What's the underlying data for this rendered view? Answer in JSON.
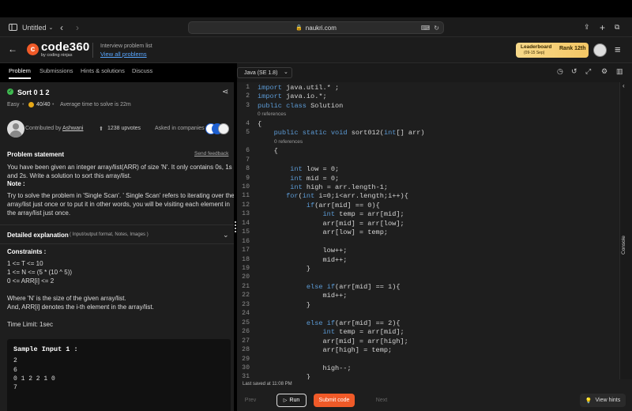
{
  "browser": {
    "tab_title": "Untitled",
    "url": "naukri.com"
  },
  "app": {
    "logo_text": "code360",
    "logo_sub": "by coding ninjas",
    "breadcrumb_label": "Interview problem list",
    "breadcrumb_link": "View all problems",
    "leaderboard_title": "Leaderboard",
    "leaderboard_dates": "(09-15 Sep)",
    "rank_label": "Rank",
    "rank_value": "12th"
  },
  "tabs": [
    "Problem",
    "Submissions",
    "Hints & solutions",
    "Discuss"
  ],
  "problem": {
    "title": "Sort 0 1 2",
    "difficulty": "Easy",
    "score": "40/40",
    "avg_time": "Average time to solve is 22m",
    "contributed_label": "Contributed by",
    "contributor": "Ashwani",
    "upvotes": "1238 upvotes",
    "asked_label": "Asked in companies",
    "statement_heading": "Problem statement",
    "feedback_link": "Send feedback",
    "statement_lines": [
      "You have been given an integer array/list(ARR) of size 'N'. It only contains 0s, 1s",
      "and 2s. Write a solution to sort this array/list."
    ],
    "note_label": "Note :",
    "note_lines": [
      "Try to solve the problem in 'Single Scan'. ' Single Scan' refers to iterating over the",
      "array/list just once or to put it in other words, you will be visiting each element in",
      "the array/list just once."
    ],
    "detailed_label": "Detailed explanation",
    "detailed_sub": "( Input/output format, Notes, Images )",
    "constraints_label": "Constraints :",
    "constraints": [
      "1 <= T <= 10",
      "1 <= N <= (5 * (10 ^ 5))",
      "0 <= ARR[i] <= 2"
    ],
    "where_lines": [
      "Where 'N' is the size of the given array/list.",
      "And, ARR[i] denotes the i-th element in the array/list."
    ],
    "time_limit": "Time Limit: 1sec",
    "sample_label": "Sample Input 1 :",
    "sample_lines": [
      "2",
      "6",
      "0 1 2 2 1 0",
      "7"
    ]
  },
  "editor": {
    "language": "Java (SE 1.8)",
    "ref_label": "0 references",
    "line_numbers": [
      "1",
      "2",
      "3",
      "4",
      "5",
      "6",
      "7",
      "8",
      "9",
      "10",
      "11",
      "12",
      "13",
      "14",
      "15",
      "16",
      "17",
      "18",
      "19",
      "20",
      "21",
      "22",
      "23",
      "24",
      "25",
      "26",
      "27",
      "28",
      "29",
      "30",
      "31"
    ],
    "code_lines": [
      "import java.util.* ;",
      "import java.io.*;",
      "public class Solution",
      "{",
      "    public static void sort012(int[] arr)",
      "    {",
      "",
      "        int low = 0;",
      "        int mid = 0;",
      "        int high = arr.length-1;",
      "       for(int i=0;i<arr.length;i++){",
      "            if(arr[mid] == 0){",
      "                int temp = arr[mid];",
      "                arr[mid] = arr[low];",
      "                arr[low] = temp;",
      "",
      "                low++;",
      "                mid++;",
      "            }",
      "",
      "            else if(arr[mid] == 1){",
      "                mid++;",
      "            }",
      "",
      "            else if(arr[mid] == 2){",
      "                int temp = arr[mid];",
      "                arr[mid] = arr[high];",
      "                arr[high] = temp;",
      "",
      "                high--;",
      "            }"
    ],
    "last_saved": "Last saved at 11:08 PM",
    "console_label": "Console"
  },
  "actions": {
    "prev": "Prev",
    "run": "Run",
    "submit": "Submit code",
    "next": "Next",
    "view_hints": "View hints"
  },
  "colors": {
    "accent": "#f05a28",
    "link": "#58a6ff",
    "keyword": "#5c9bd6"
  }
}
